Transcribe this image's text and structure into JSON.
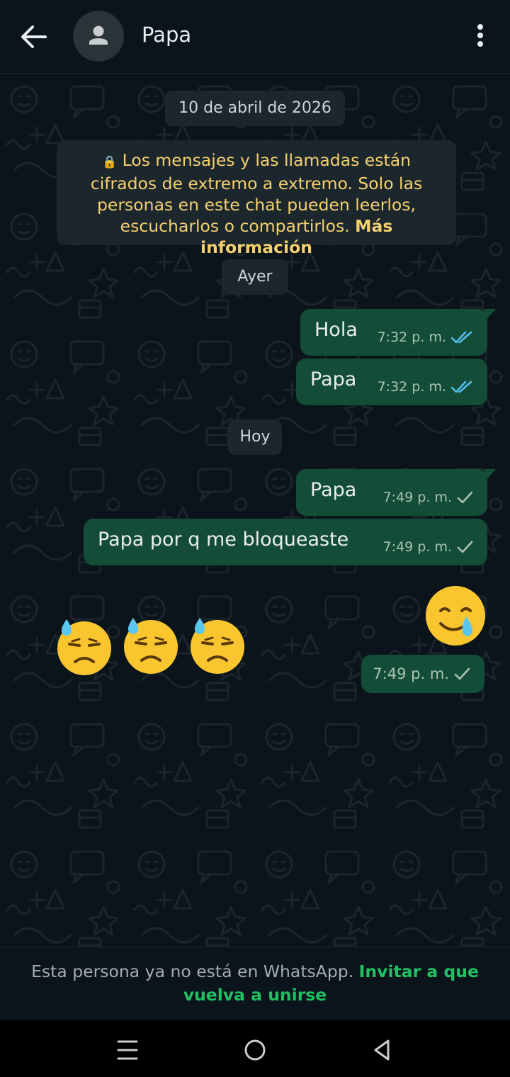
{
  "header": {
    "contact_name": "Papa",
    "back_icon": "arrow-left-icon",
    "avatar_icon": "person-icon",
    "menu_icon": "more-vertical-icon"
  },
  "chat": {
    "date_first": "10 de abril de 2026",
    "encryption_notice": {
      "icon": "lock-icon",
      "text": "Los mensajes y las llamadas están cifrados de extremo a extremo. Solo las personas en este chat pueden leerlos, escucharlos o compartirlos.",
      "link": "Más información"
    },
    "date_yesterday": "Ayer",
    "date_today": "Hoy",
    "messages": [
      {
        "text": "Hola",
        "time": "7:32 p. m.",
        "status": "read"
      },
      {
        "text": "Papa",
        "time": "7:32 p. m.",
        "status": "read"
      },
      {
        "text": "Papa",
        "time": "7:49 p. m.",
        "status": "sent"
      },
      {
        "text": "Papa por q me bloqueaste",
        "time": "7:49 p. m.",
        "status": "sent"
      }
    ],
    "emoji_message": {
      "emojis": [
        "downcast-face-with-sweat",
        "downcast-face-with-sweat",
        "downcast-face-with-sweat",
        "smiling-face-with-tear"
      ],
      "time": "7:49 p. m.",
      "status": "sent"
    }
  },
  "footer": {
    "text": "Esta persona ya no está en WhatsApp.",
    "link": "Invitar a que vuelva a unirse"
  },
  "navbar": {
    "icons": [
      "recents-icon",
      "home-icon",
      "back-triangle-icon"
    ]
  },
  "colors": {
    "background": "#0b141a",
    "outgoing_bubble": "#144d37",
    "system_chip": "#1c272d",
    "notice_text": "#f4d06f",
    "read_ticks": "#53bdeb",
    "link_green": "#21c063"
  }
}
